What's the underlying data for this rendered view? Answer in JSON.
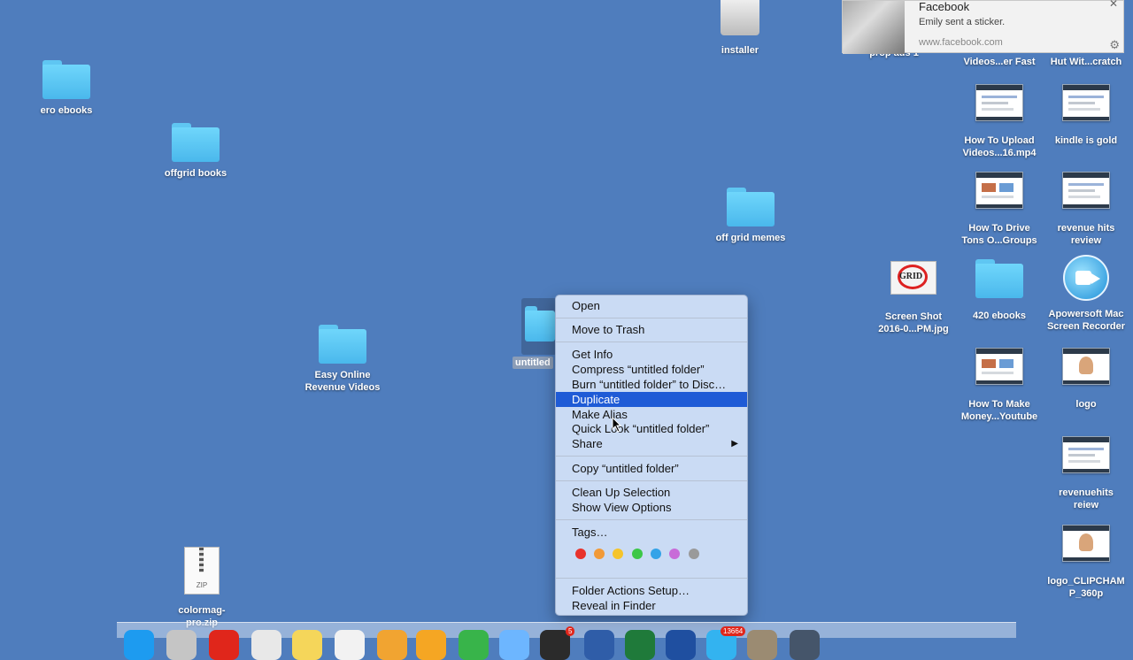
{
  "notification": {
    "app": "Facebook",
    "message": "Emily sent a sticker.",
    "url": "www.facebook.com"
  },
  "desktop_icons": {
    "ero_ebooks": "ero ebooks",
    "offgrid_books": "offgrid books",
    "installer": "installer",
    "off_grid_memes": "off grid memes",
    "easy_online": [
      "Easy Online",
      "Revenue Videos"
    ],
    "untitled": "untitled",
    "colormag": [
      "colormag-",
      "pro.zip"
    ],
    "prop_ads": "prop ads 1",
    "how_to_upload_fast": "Videos...er Fast",
    "hut_with_scratch": "Hut Wit...cratch",
    "how_to_upload_16": [
      "How To Upload",
      "Videos...16.mp4"
    ],
    "kindle_is_gold": "kindle is gold",
    "how_to_drive": [
      "How To Drive",
      "Tons O...Groups"
    ],
    "revenue_hits_review": [
      "revenue hits",
      "review"
    ],
    "screen_shot": [
      "Screen Shot",
      "2016-0...PM.jpg"
    ],
    "ebooks_420": "420 ebooks",
    "apowersoft": [
      "Apowersoft Mac",
      "Screen Recorder"
    ],
    "how_to_make_money": [
      "How To Make",
      "Money...Youtube"
    ],
    "logo": "logo",
    "revenuehits_reiew": [
      "revenuehits",
      "reiew"
    ],
    "logo_clipchamp": [
      "logo_CLIPCHAM",
      "P_360p"
    ]
  },
  "context_menu": {
    "open": "Open",
    "move_to_trash": "Move to Trash",
    "get_info": "Get Info",
    "compress": "Compress “untitled folder”",
    "burn": "Burn “untitled folder” to Disc…",
    "duplicate": "Duplicate",
    "make_alias": "Make Alias",
    "quick_look": "Quick Look “untitled folder”",
    "share": "Share",
    "copy": "Copy “untitled folder”",
    "clean_up": "Clean Up Selection",
    "show_view_options": "Show View Options",
    "tags": "Tags…",
    "tag_colors": [
      "#e8322b",
      "#f19a38",
      "#f5c42b",
      "#3cc747",
      "#33a3e8",
      "#c86bd8",
      "#9a9a9a"
    ],
    "folder_actions": "Folder Actions Setup…",
    "reveal_in_finder": "Reveal in Finder"
  },
  "dock": {
    "badge_mail": "5",
    "badge_count": "13664",
    "app_colors": [
      "#1d9bf0",
      "#c5c5c5",
      "#e0261b",
      "#e8e8e8",
      "#f5d65a",
      "#f2f2f2",
      "#f1a431",
      "#f5a623",
      "#38b44a",
      "#6db6ff",
      "#2b2b2b",
      "#2f5da8",
      "#1f7a3a",
      "#1f4fa0",
      "#33b3f0",
      "#9b8b72",
      "#45556a"
    ]
  },
  "colors": {
    "desktop": "#4f7dbd",
    "menu_highlight": "#1f5bd6"
  }
}
